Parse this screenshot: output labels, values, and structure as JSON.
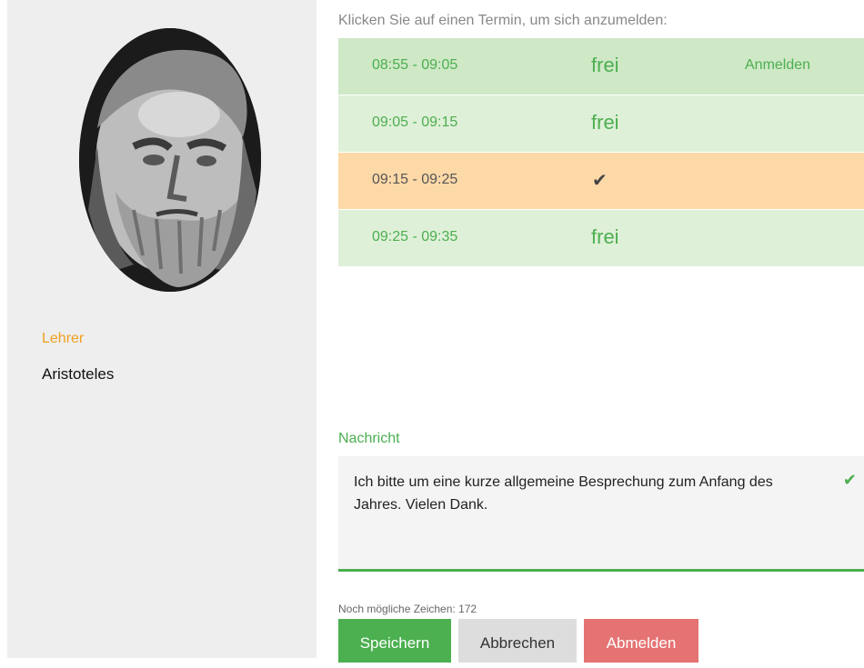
{
  "profile": {
    "role": "Lehrer",
    "name": "Aristoteles"
  },
  "booking": {
    "instruction": "Klicken Sie auf einen Termin, um sich anzumelden:",
    "slots": [
      {
        "time": "08:55 - 09:05",
        "status": "frei",
        "action": "Anmelden",
        "state": "free"
      },
      {
        "time": "09:05 - 09:15",
        "status": "frei",
        "state": "free"
      },
      {
        "time": "09:15 - 09:25",
        "status": "",
        "state": "booked",
        "icon": "checkmark-icon"
      },
      {
        "time": "09:25 - 09:35",
        "status": "frei",
        "state": "free"
      }
    ]
  },
  "message": {
    "label": "Nachricht",
    "text": "Ich bitte um eine kurze allgemeine Besprechung zum Anfang des Jahres. Vielen Dank.",
    "remaining_label": "Noch mögliche Zeichen: 172"
  },
  "buttons": {
    "save": "Speichern",
    "cancel": "Abbrechen",
    "logout": "Abmelden"
  },
  "colors": {
    "accent_green": "#4caf50",
    "slot_free": "#dff0d8",
    "slot_booked": "#fdd9a8",
    "role_orange": "#f0a020",
    "logout_red": "#e57373"
  }
}
